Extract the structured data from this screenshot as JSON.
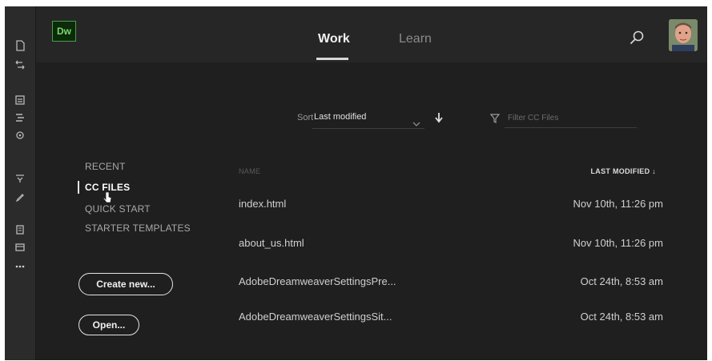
{
  "app": {
    "logo_text": "Dw",
    "tabs": [
      {
        "label": "Work",
        "active": true
      },
      {
        "label": "Learn",
        "active": false
      }
    ]
  },
  "toolbar": {
    "icons": [
      "file-icon",
      "code-arrows-icon",
      "files-panel-icon",
      "insert-icon",
      "css-designer-icon",
      "snippets-icon",
      "pen-icon",
      "dom-icon",
      "assets-icon",
      "more-icon"
    ]
  },
  "sort": {
    "label": "Sort",
    "value": "Last modified",
    "direction": "descending"
  },
  "filter": {
    "placeholder": "Filter CC Files",
    "value": ""
  },
  "nav": {
    "items": [
      {
        "label": "RECENT",
        "active": false
      },
      {
        "label": "CC FILES",
        "active": true
      },
      {
        "label": "QUICK START",
        "active": false
      },
      {
        "label": "STARTER TEMPLATES",
        "active": false
      }
    ]
  },
  "buttons": {
    "create_new": "Create new...",
    "open": "Open..."
  },
  "files": {
    "columns": {
      "name": "NAME",
      "last_modified": "LAST MODIFIED ↓"
    },
    "rows": [
      {
        "name": "index.html",
        "modified": "Nov 10th, 11:26 pm"
      },
      {
        "name": "about_us.html",
        "modified": "Nov 10th, 11:26 pm"
      },
      {
        "name": "AdobeDreamweaverSettingsPre...",
        "modified": "Oct 24th, 8:53 am"
      },
      {
        "name": "AdobeDreamweaverSettingsSit...",
        "modified": "Oct 24th, 8:53 am"
      }
    ]
  },
  "colors": {
    "background": "#1f1f1f",
    "header": "#262626",
    "toolbar": "#2b2b2b",
    "logo_accent": "#46a04a",
    "text": "#cfcfcf"
  }
}
